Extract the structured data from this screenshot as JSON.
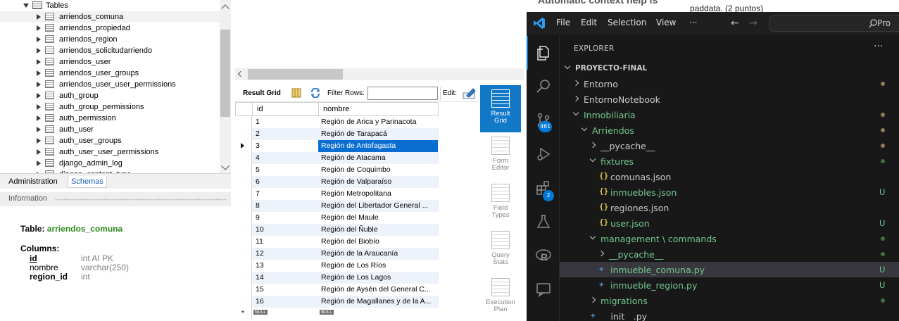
{
  "workbench": {
    "tree": {
      "root_label": "Tables",
      "items": [
        {
          "label": "arriendos_comuna",
          "selected": true
        },
        {
          "label": "arriendos_propiedad"
        },
        {
          "label": "arriendos_region"
        },
        {
          "label": "arriendos_solicitudarriendo"
        },
        {
          "label": "arriendos_user"
        },
        {
          "label": "arriendos_user_groups"
        },
        {
          "label": "arriendos_user_user_permissions"
        },
        {
          "label": "auth_group"
        },
        {
          "label": "auth_group_permissions"
        },
        {
          "label": "auth_permission"
        },
        {
          "label": "auth_user"
        },
        {
          "label": "auth_user_groups"
        },
        {
          "label": "auth_user_user_permissions"
        },
        {
          "label": "django_admin_log"
        },
        {
          "label": "django_content_type"
        }
      ]
    },
    "tabs": {
      "administration": "Administration",
      "schemas": "Schemas"
    },
    "info": {
      "header": "Information",
      "table_label": "Table:",
      "table_name": "arriendos_comuna",
      "columns_label": "Columns:",
      "columns": [
        {
          "name": "id",
          "type": "int AI PK"
        },
        {
          "name": "nombre",
          "type": "varchar(250)"
        },
        {
          "name": "region_id",
          "type": "int"
        }
      ]
    },
    "result_toolbar": {
      "result_grid": "Result Grid",
      "filter_rows": "Filter Rows:",
      "filter_value": "",
      "edit": "Edit:"
    },
    "grid": {
      "columns": [
        "id",
        "nombre"
      ],
      "rows": [
        {
          "id": "1",
          "nombre": "Región de Arica y Parinacota"
        },
        {
          "id": "2",
          "nombre": "Región de Tarapacá"
        },
        {
          "id": "3",
          "nombre": "Región de Antofagasta",
          "selected": true
        },
        {
          "id": "4",
          "nombre": "Región de Atacama"
        },
        {
          "id": "5",
          "nombre": "Región de Coquimbo"
        },
        {
          "id": "6",
          "nombre": "Región de Valparaíso"
        },
        {
          "id": "7",
          "nombre": "Región Metropolitana"
        },
        {
          "id": "8",
          "nombre": "Región del Libertador General ..."
        },
        {
          "id": "9",
          "nombre": "Región del Maule"
        },
        {
          "id": "10",
          "nombre": "Región del Ñuble"
        },
        {
          "id": "11",
          "nombre": "Región del Biobío"
        },
        {
          "id": "12",
          "nombre": "Región de la Araucanía"
        },
        {
          "id": "13",
          "nombre": "Región de Los Ríos"
        },
        {
          "id": "14",
          "nombre": "Región de Los Lagos"
        },
        {
          "id": "15",
          "nombre": "Región de Aysén del General C..."
        },
        {
          "id": "16",
          "nombre": "Región de Magallanes y de la A..."
        }
      ],
      "new_row_marker": "*",
      "null_label": "NULL"
    },
    "side_panel": [
      {
        "label": "Result Grid",
        "active": true
      },
      {
        "label": "Form Editor"
      },
      {
        "label": "Field Types"
      },
      {
        "label": "Query Stats"
      },
      {
        "label": "Execution Plan"
      }
    ]
  },
  "behind_window": {
    "line1": "Automatic context help is",
    "line2": "paddata. (2 puntos)"
  },
  "vscode": {
    "menu": [
      "File",
      "Edit",
      "Selection",
      "View",
      "···"
    ],
    "search_text": "Pro",
    "explorer_title": "EXPLORER",
    "explorer_more": "···",
    "activity": [
      {
        "icon": "files-icon",
        "active": true
      },
      {
        "icon": "search-icon"
      },
      {
        "icon": "source-control-icon",
        "badge": "461"
      },
      {
        "icon": "run-debug-icon"
      },
      {
        "icon": "extensions-icon",
        "badge": "2"
      },
      {
        "icon": "testing-flask-icon"
      },
      {
        "icon": "r-language-icon"
      },
      {
        "icon": "remote-explorer-icon"
      }
    ],
    "accent": "#0078d4",
    "untracked_color": "#73c991",
    "files": [
      {
        "name": "PROYECTO-FINAL",
        "kind": "root",
        "level": 0
      },
      {
        "name": "Entorno",
        "kind": "folder",
        "level": 1,
        "open": false,
        "dot": "#8b7d56"
      },
      {
        "name": "EntornoNotebook",
        "kind": "folder",
        "level": 1,
        "open": false
      },
      {
        "name": "Inmobiliaria",
        "kind": "folder",
        "level": 1,
        "open": true,
        "dot": "#8b7d56",
        "green": true
      },
      {
        "name": "Arriendos",
        "kind": "folder",
        "level": 2,
        "open": true,
        "dot": "#8b7d56",
        "green": true
      },
      {
        "name": "__pycache__",
        "kind": "folder",
        "level": 3,
        "open": false,
        "dot": "#8b7d56"
      },
      {
        "name": "fixtures",
        "kind": "folder",
        "level": 3,
        "open": true,
        "dot": "#3f6e4a",
        "green": true
      },
      {
        "name": "comunas.json",
        "kind": "json",
        "level": 4
      },
      {
        "name": "inmuebles.json",
        "kind": "json",
        "level": 4,
        "status": "U",
        "green": true
      },
      {
        "name": "regiones.json",
        "kind": "json",
        "level": 4
      },
      {
        "name": "user.json",
        "kind": "json",
        "level": 4,
        "status": "U",
        "green": true
      },
      {
        "name": "management \\ commands",
        "kind": "folder",
        "level": 3,
        "open": true,
        "dot": "#3f6e4a",
        "green": true
      },
      {
        "name": "__pycache__",
        "kind": "folder",
        "level": 4,
        "open": false,
        "dot": "#3f6e4a",
        "green": true
      },
      {
        "name": "inmueble_comuna.py",
        "kind": "py",
        "level": 4,
        "status": "U",
        "green": true,
        "selected": true
      },
      {
        "name": "inmueble_region.py",
        "kind": "py",
        "level": 4,
        "status": "U",
        "green": true
      },
      {
        "name": "migrations",
        "kind": "folder",
        "level": 3,
        "open": false,
        "dot": "#3f6e4a",
        "green": true
      },
      {
        "name": "__init__.py",
        "kind": "py",
        "level": 3
      }
    ]
  }
}
